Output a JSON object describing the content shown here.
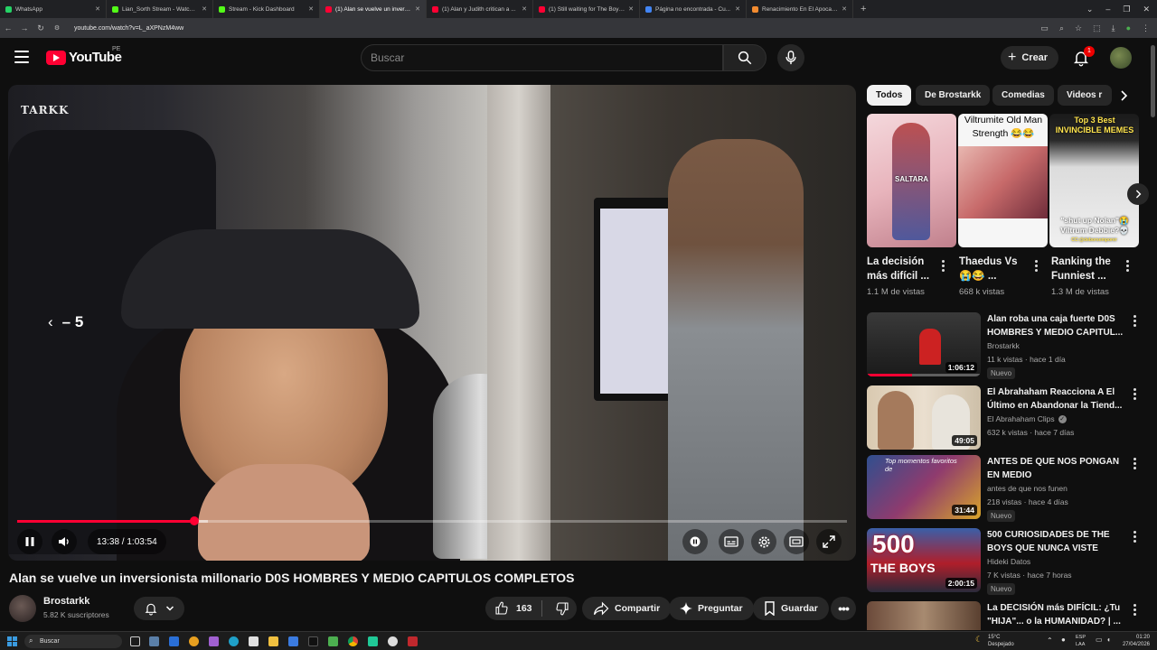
{
  "browser": {
    "tabs": [
      {
        "title": "WhatsApp",
        "color": "#25d366"
      },
      {
        "title": "Lian_Sorth Stream - Watch Live...",
        "color": "#53fc18"
      },
      {
        "title": "Stream - Kick Dashboard",
        "color": "#53fc18"
      },
      {
        "title": "(1) Alan se vuelve un invers...",
        "color": "#ff0033",
        "active": true
      },
      {
        "title": "(1) Alan y Judith critican a ...",
        "color": "#ff0033"
      },
      {
        "title": "(1) Still waiting for The Boys S5...",
        "color": "#ff0033"
      },
      {
        "title": "Página no encontrada - Cu...",
        "color": "#4285f4"
      },
      {
        "title": "Renacimiento En El Apocalipsis...",
        "color": "#f28b30"
      }
    ],
    "url": "youtube.com/watch?v=L_aXPNzM4ww"
  },
  "header": {
    "logo_text": "YouTube",
    "country_code": "PE",
    "search_placeholder": "Buscar",
    "create_label": "Crear",
    "notification_count": "1"
  },
  "player": {
    "watermark": "TARKK",
    "seek_indicator": "– 5",
    "current_time": "13:38",
    "duration": "1:03:54",
    "time_display": "13:38 / 1:03:54",
    "progress_fraction": 0.2134,
    "buffered_fraction": 0.23
  },
  "video": {
    "title": "Alan se vuelve un inversionista millonario D0S HOMBRES Y MEDIO CAPITULOS COMPLETOS",
    "channel": "Brostarkk",
    "subscribers": "5.82 K suscriptores",
    "likes": "163",
    "share_label": "Compartir",
    "ask_label": "Preguntar",
    "save_label": "Guardar"
  },
  "sidebar": {
    "chips": [
      "Todos",
      "De Brostarkk",
      "Comedias",
      "Videos r"
    ],
    "shorts": [
      {
        "caption": "SALTARA",
        "title": "La decisión más difícil ...",
        "views": "1.1 M de vistas"
      },
      {
        "caption": "Viltrumite Old Man Strength 😂😂",
        "title": "Thaedus Vs 😭😂 ...",
        "views": "668 k vistas"
      },
      {
        "caption": "Top 3 Best INVINCIBLE MEMES",
        "caption2": "\"shut up Nolan\"😭 Viltrum Debbie?💀",
        "handle": "CC:@deborsemporer",
        "title": "Ranking the Funniest ...",
        "views": "1.3 M de vistas"
      }
    ],
    "videos": [
      {
        "title": "Alan roba una caja fuerte D0S HOMBRES Y MEDIO CAPITUL...",
        "channel": "Brostarkk",
        "meta": "11 k vistas · hace 1 día",
        "duration": "1:06:12",
        "badge": "Nuevo",
        "verified": false
      },
      {
        "title": "El Abrahaham Reacciona A El Último en Abandonar la Tiend...",
        "channel": "El Abrahaham Clips",
        "meta": "632 k vistas · hace 7 días",
        "duration": "49:05",
        "badge": "",
        "verified": true
      },
      {
        "title": "ANTES DE QUE NOS PONGAN EN MEDIO",
        "channel": "antes de que nos funen",
        "meta": "218 vistas · hace 4 días",
        "duration": "31:44",
        "badge": "Nuevo",
        "verified": false
      },
      {
        "title": "500 CURIOSIDADES DE THE BOYS QUE NUNCA VISTE",
        "channel": "Hideki Datos",
        "meta": "7 K vistas · hace 7 horas",
        "duration": "2:00:15",
        "badge": "Nuevo",
        "verified": false
      },
      {
        "title": "La DECISIÓN más DIFÍCIL: ¿Tu \"HIJA\"... o la HUMANIDAD? | ...",
        "channel": "",
        "meta": "",
        "duration": "",
        "badge": "",
        "verified": false
      }
    ],
    "thumb_overlays": [
      "Top momentos favoritos de",
      "500",
      "THE BOYS"
    ]
  },
  "taskbar": {
    "search_placeholder": "Buscar",
    "weather_temp": "15°C",
    "weather_desc": "Despejado",
    "lang": "ESP",
    "lang2": "LAA",
    "time": "01:20",
    "date": "27/04/2026"
  }
}
